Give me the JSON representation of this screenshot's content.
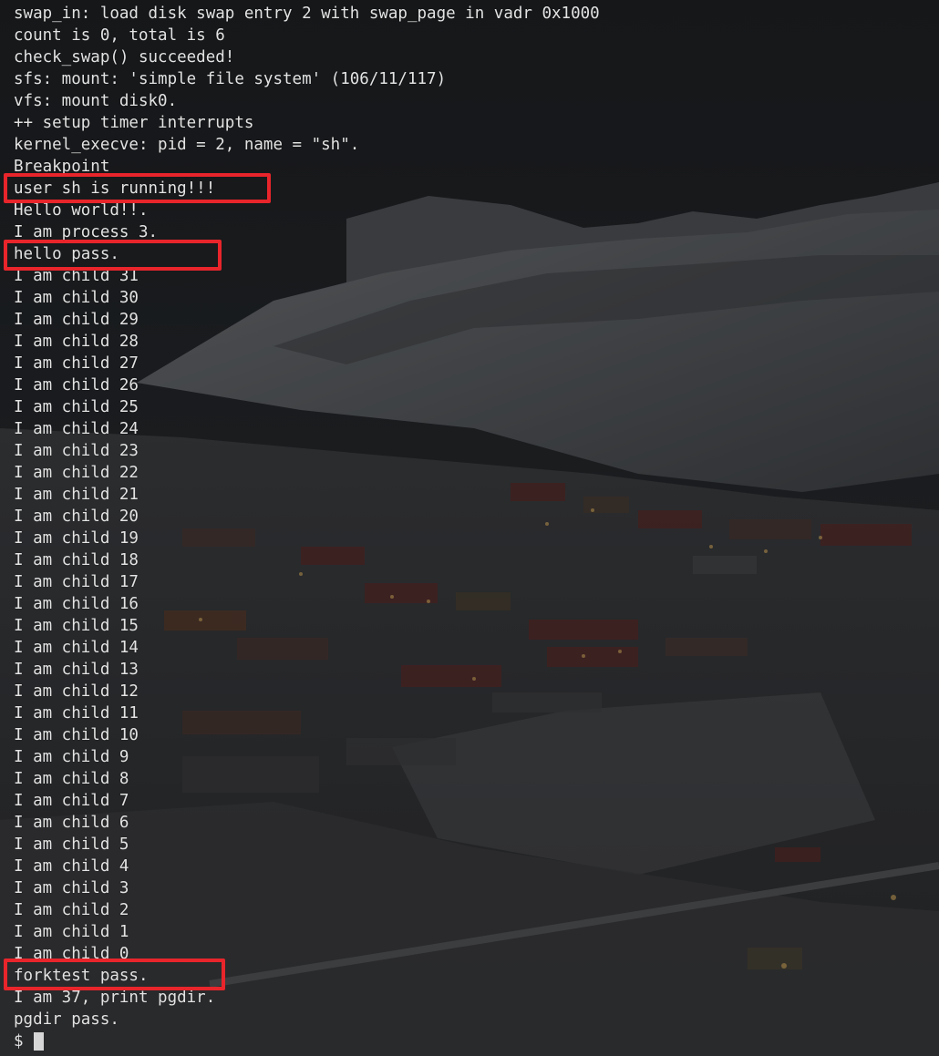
{
  "terminal": {
    "lines": [
      "swap_in: load disk swap entry 2 with swap_page in vadr 0x1000",
      "count is 0, total is 6",
      "check_swap() succeeded!",
      "sfs: mount: 'simple file system' (106/11/117)",
      "vfs: mount disk0.",
      "++ setup timer interrupts",
      "kernel_execve: pid = 2, name = \"sh\".",
      "Breakpoint",
      "user sh is running!!!",
      "Hello world!!.",
      "I am process 3.",
      "hello pass.",
      "I am child 31",
      "I am child 30",
      "I am child 29",
      "I am child 28",
      "I am child 27",
      "I am child 26",
      "I am child 25",
      "I am child 24",
      "I am child 23",
      "I am child 22",
      "I am child 21",
      "I am child 20",
      "I am child 19",
      "I am child 18",
      "I am child 17",
      "I am child 16",
      "I am child 15",
      "I am child 14",
      "I am child 13",
      "I am child 12",
      "I am child 11",
      "I am child 10",
      "I am child 9",
      "I am child 8",
      "I am child 7",
      "I am child 6",
      "I am child 5",
      "I am child 4",
      "I am child 3",
      "I am child 2",
      "I am child 1",
      "I am child 0",
      "forktest pass.",
      "I am 37, print pgdir.",
      "pgdir pass."
    ],
    "prompt": "$",
    "highlighted_lines": [
      "user sh is running!!!",
      "hello pass.",
      "forktest pass."
    ]
  },
  "colors": {
    "text": "#e3e3e3",
    "highlight_border": "#e8252b",
    "cursor": "#d6d6d6"
  }
}
